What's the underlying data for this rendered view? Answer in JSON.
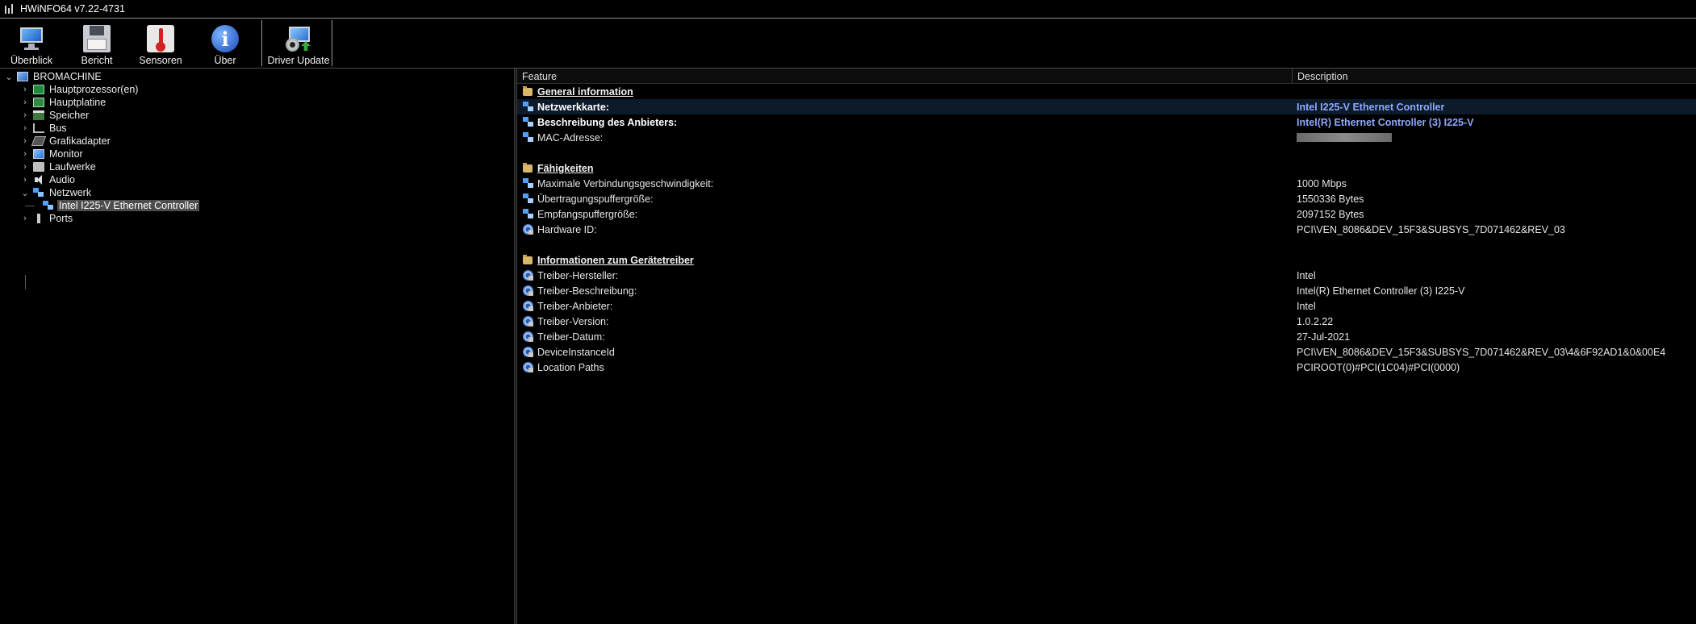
{
  "window": {
    "title": "HWiNFO64 v7.22-4731"
  },
  "toolbar": {
    "overview_label": "Überblick",
    "report_label": "Bericht",
    "sensors_label": "Sensoren",
    "about_label": "Über",
    "driver_update_label": "Driver Update"
  },
  "tree": {
    "root": "BROMACHINE",
    "items": [
      {
        "label": "Hauptprozessor(en)",
        "icon": "cpu-icon"
      },
      {
        "label": "Hauptplatine",
        "icon": "motherboard-icon"
      },
      {
        "label": "Speicher",
        "icon": "memory-icon"
      },
      {
        "label": "Bus",
        "icon": "bus-icon"
      },
      {
        "label": "Grafikadapter",
        "icon": "gpu-icon"
      },
      {
        "label": "Monitor",
        "icon": "monitor-icon"
      },
      {
        "label": "Laufwerke",
        "icon": "drive-icon"
      },
      {
        "label": "Audio",
        "icon": "speaker-icon"
      },
      {
        "label": "Netzwerk",
        "icon": "network-icon"
      },
      {
        "label": "Ports",
        "icon": "port-icon"
      }
    ],
    "network_child": "Intel I225-V Ethernet Controller"
  },
  "details": {
    "columns": {
      "feature": "Feature",
      "description": "Description"
    },
    "sections": {
      "general": {
        "title": "General information",
        "rows": [
          {
            "feature": "Netzwerkkarte:",
            "value": "Intel I225-V Ethernet Controller"
          },
          {
            "feature": "Beschreibung des Anbieters:",
            "value": "Intel(R) Ethernet Controller (3) I225-V"
          },
          {
            "feature": "MAC-Adresse:",
            "value": ""
          }
        ]
      },
      "capabilities": {
        "title": "Fähigkeiten",
        "rows": [
          {
            "feature": "Maximale Verbindungsgeschwindigkeit:",
            "value": "1000 Mbps"
          },
          {
            "feature": "Übertragungspuffergröße:",
            "value": "1550336 Bytes"
          },
          {
            "feature": "Empfangspuffergröße:",
            "value": "2097152 Bytes"
          },
          {
            "feature": "Hardware ID:",
            "value": "PCI\\VEN_8086&DEV_15F3&SUBSYS_7D071462&REV_03"
          }
        ]
      },
      "driver": {
        "title": "Informationen zum Gerätetreiber",
        "rows": [
          {
            "feature": "Treiber-Hersteller:",
            "value": "Intel"
          },
          {
            "feature": "Treiber-Beschreibung:",
            "value": "Intel(R) Ethernet Controller (3) I225-V"
          },
          {
            "feature": "Treiber-Anbieter:",
            "value": "Intel"
          },
          {
            "feature": "Treiber-Version:",
            "value": "1.0.2.22"
          },
          {
            "feature": "Treiber-Datum:",
            "value": "27-Jul-2021"
          },
          {
            "feature": "DeviceInstanceId",
            "value": "PCI\\VEN_8086&DEV_15F3&SUBSYS_7D071462&REV_03\\4&6F92AD1&0&00E4"
          },
          {
            "feature": "Location Paths",
            "value": "PCIROOT(0)#PCI(1C04)#PCI(0000)"
          }
        ]
      }
    }
  },
  "colors": {
    "highlight_value": "#8fa8ff",
    "selection": "#4d4d4d",
    "background": "#000000"
  }
}
